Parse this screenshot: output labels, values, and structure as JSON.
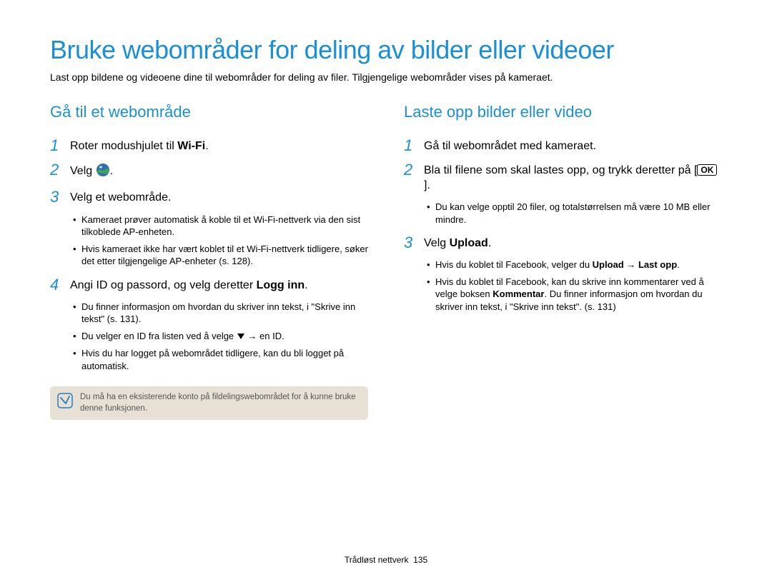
{
  "title": "Bruke webområder for deling av bilder eller videoer",
  "intro": "Last opp bildene og videoene dine til webområder for deling av filer. Tilgjengelige webområder vises på kameraet.",
  "left": {
    "heading": "Gå til et webområde",
    "step1_pre": "Roter modushjulet til ",
    "step1_bold": "Wi-Fi",
    "step1_post": ".",
    "step2_pre": "Velg ",
    "step2_post": ".",
    "step3": "Velg et webområde.",
    "step3_bullets": [
      "Kameraet prøver automatisk å koble til et Wi-Fi-nettverk via den sist tilkoblede AP-enheten.",
      "Hvis kameraet ikke har vært koblet til et Wi-Fi-nettverk tidligere, søker det etter tilgjengelige AP-enheter (s. 128)."
    ],
    "step4_pre": "Angi ID og passord, og velg deretter ",
    "step4_bold": "Logg inn",
    "step4_post": ".",
    "step4_b1": "Du finner informasjon om hvordan du skriver inn tekst, i \"Skrive inn tekst\" (s. 131).",
    "step4_b2_pre": "Du velger en ID fra listen ved å velge ",
    "step4_b2_post": " → en ID.",
    "step4_b3": "Hvis du har logget på webområdet tidligere, kan du bli logget på automatisk.",
    "note": "Du må ha en eksisterende konto på fildelingswebområdet for å kunne bruke denne funksjonen."
  },
  "right": {
    "heading": "Laste opp bilder eller video",
    "step1": "Gå til webområdet med kameraet.",
    "step2_pre": "Bla til filene som skal lastes opp, og trykk deretter på [",
    "step2_ok": "OK",
    "step2_post": "].",
    "step2_bullets": [
      "Du kan velge opptil 20 filer, og totalstørrelsen må være 10 MB eller mindre."
    ],
    "step3_pre": "Velg ",
    "step3_bold": "Upload",
    "step3_post": ".",
    "step3_b1_pre": "Hvis du koblet til Facebook, velger du ",
    "step3_b1_bold1": "Upload",
    "step3_b1_mid": " → ",
    "step3_b1_bold2": "Last opp",
    "step3_b1_post": ".",
    "step3_b2_pre": "Hvis du koblet til Facebook, kan du skrive inn kommentarer ved å velge boksen ",
    "step3_b2_bold": "Kommentar",
    "step3_b2_post": ". Du finner informasjon om hvordan du skriver inn tekst, i \"Skrive inn tekst\". (s. 131)"
  },
  "footer_label": "Trådløst nettverk",
  "footer_page": "135"
}
